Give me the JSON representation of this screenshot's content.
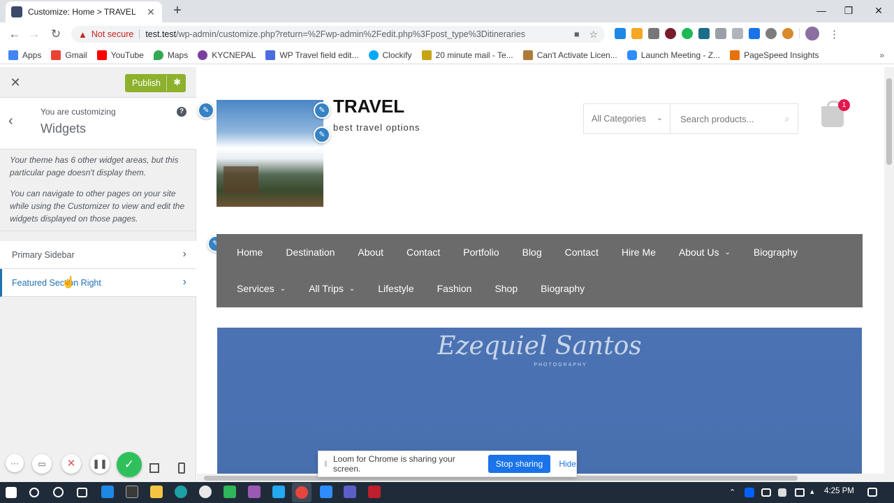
{
  "browser": {
    "tab_title": "Customize: Home > TRAVEL",
    "tab_close": "✕",
    "new_tab": "+",
    "security_label": "Not secure",
    "url_host": "test.test",
    "url_path": "/wp-admin/customize.php?return=%2Fwp-admin%2Fedit.php%3Fpost_type%3Ditineraries"
  },
  "bookmarks": [
    {
      "label": "Apps",
      "color": "#4285f4"
    },
    {
      "label": "Gmail",
      "color": "#ea4335"
    },
    {
      "label": "YouTube",
      "color": "#ff0000"
    },
    {
      "label": "Maps",
      "color": "#34a853"
    },
    {
      "label": "KYCNEPAL",
      "color": "#7b3fa0"
    },
    {
      "label": "WP Travel field edit...",
      "color": "#4a6ee0"
    },
    {
      "label": "Clockify",
      "color": "#03a9f4"
    },
    {
      "label": "20 minute mail - Te...",
      "color": "#c8a415"
    },
    {
      "label": "Can't Activate Licen...",
      "color": "#b07a3a"
    },
    {
      "label": "Launch Meeting - Z...",
      "color": "#2d8cff"
    },
    {
      "label": "PageSpeed Insights",
      "color": "#e8710a"
    }
  ],
  "customizer": {
    "publish_label": "Publish",
    "customizing_label": "You are customizing",
    "customizing_title": "Widgets",
    "help": "?",
    "notice_1": "Your theme has 6 other widget areas, but this particular page doesn't display them.",
    "notice_2": "You can navigate to other pages on your site while using the Customizer to view and edit the widgets displayed on those pages.",
    "sections": [
      {
        "label": "Primary Sidebar"
      },
      {
        "label": "Featured Section Right"
      }
    ]
  },
  "site": {
    "title": "TRAVEL",
    "tagline": "best travel options",
    "category_select": "All Categories",
    "search_placeholder": "Search products...",
    "cart_count": "1",
    "nav_row1": [
      {
        "label": "Home",
        "dropdown": ""
      },
      {
        "label": "Destination",
        "dropdown": ""
      },
      {
        "label": "About",
        "dropdown": ""
      },
      {
        "label": "Contact",
        "dropdown": ""
      },
      {
        "label": "Portfolio",
        "dropdown": ""
      },
      {
        "label": "Blog",
        "dropdown": ""
      },
      {
        "label": "Contact",
        "dropdown": ""
      },
      {
        "label": "Hire Me",
        "dropdown": ""
      },
      {
        "label": "About Us",
        "dropdown": "⌄"
      },
      {
        "label": "Biography",
        "dropdown": ""
      }
    ],
    "nav_row2": [
      {
        "label": "Services",
        "dropdown": "⌄"
      },
      {
        "label": "All Trips",
        "dropdown": "⌄"
      },
      {
        "label": "Lifestyle",
        "dropdown": ""
      },
      {
        "label": "Fashion",
        "dropdown": ""
      },
      {
        "label": "Shop",
        "dropdown": ""
      },
      {
        "label": "Biography",
        "dropdown": ""
      }
    ],
    "hero_signature": "Ezequiel Santos",
    "hero_sub": "PHOTOGRAPHY"
  },
  "loom": {
    "message": "Loom for Chrome is sharing your screen.",
    "stop_label": "Stop sharing",
    "hide_label": "Hide"
  },
  "taskbar": {
    "time": "4:25 PM"
  },
  "colors": {
    "publish": "#8db12d",
    "accent": "#2271b1",
    "nav_bg": "#6b6b6b",
    "loom_blue": "#1a73e8",
    "cart_badge": "#e3194f"
  }
}
